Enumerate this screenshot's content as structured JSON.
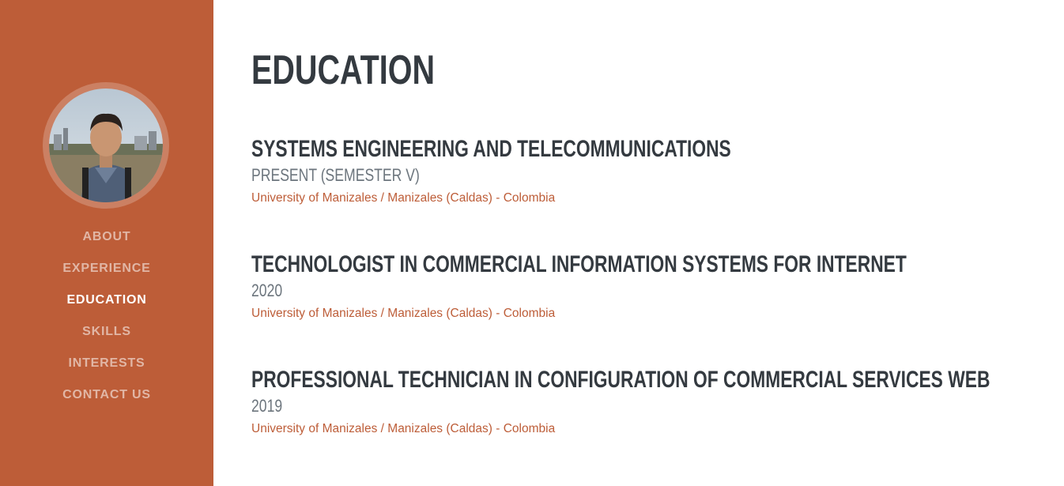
{
  "sidebar": {
    "background": "#bd5d38",
    "avatar_alt": "profile photo",
    "nav": [
      {
        "label": "ABOUT",
        "active": false
      },
      {
        "label": "EXPERIENCE",
        "active": false
      },
      {
        "label": "EDUCATION",
        "active": true
      },
      {
        "label": "SKILLS",
        "active": false
      },
      {
        "label": "INTERESTS",
        "active": false
      },
      {
        "label": "CONTACT US",
        "active": false
      }
    ]
  },
  "main": {
    "title": "EDUCATION",
    "entries": [
      {
        "title": "SYSTEMS ENGINEERING AND TELECOMMUNICATIONS",
        "subtitle": "PRESENT (SEMESTER V)",
        "place": "University of Manizales / Manizales (Caldas) - Colombia"
      },
      {
        "title": "TECHNOLOGIST IN COMMERCIAL INFORMATION SYSTEMS FOR INTERNET",
        "subtitle": "2020",
        "place": "University of Manizales / Manizales (Caldas) - Colombia"
      },
      {
        "title": "PROFESSIONAL TECHNICIAN IN CONFIGURATION OF COMMERCIAL SERVICES WEB",
        "subtitle": "2019",
        "place": "University of Manizales / Manizales (Caldas) - Colombia"
      }
    ]
  },
  "colors": {
    "accent": "#bd5d38",
    "heading": "#343a40",
    "muted": "#6c757d"
  }
}
